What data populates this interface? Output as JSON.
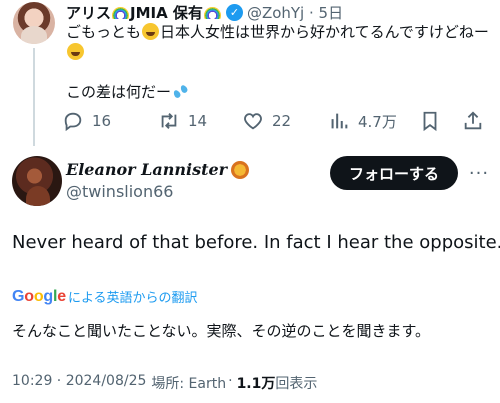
{
  "parent_tweet": {
    "display_name_part1": "アリス",
    "display_name_part2": "JMIA 保有",
    "verified_mark": "✓",
    "handle_time": "@ZohYj · 5日",
    "line1_prefix": "ごもっとも",
    "line1_suffix": "日本人女性は世界から好かれてるんですけどねー",
    "line3": "この差は何だー",
    "actions": {
      "reply_count": "16",
      "retweet_count": "14",
      "like_count": "22",
      "views_count": "4.7万"
    }
  },
  "main_tweet": {
    "display_name": "Eleanor Lannister",
    "handle": "@twinslion66",
    "follow_label": "フォローする",
    "more_label": "···",
    "text": "Never heard of that before. In fact I hear the opposite.",
    "translation_link": "による英語からの翻訳",
    "translated_text": "そんなこと聞いたことない。実際、その逆のことを聞きます。",
    "time_date": "10:29 · 2024/08/25",
    "location": "場所: Earth",
    "views_number": "1.1万",
    "views_suffix": "回表示"
  },
  "brand": {
    "google_letters": [
      "G",
      "o",
      "o",
      "g",
      "l",
      "e"
    ],
    "google_colors": [
      "#4285f4",
      "#ea4335",
      "#fbbc05",
      "#4285f4",
      "#34a853",
      "#ea4335"
    ]
  },
  "colors": {
    "text_primary": "#0f1419",
    "text_secondary": "#536471",
    "link": "#1d9bf0",
    "follow_button_bg": "#0f1419"
  },
  "icons": [
    "reply-icon",
    "retweet-icon",
    "like-icon",
    "views-icon",
    "bookmark-icon",
    "share-icon",
    "verified-icon",
    "lion-emoji-icon",
    "grin-sweat-emoji-icon",
    "sweat-drops-emoji-icon",
    "rainbow-emoji-icon"
  ]
}
